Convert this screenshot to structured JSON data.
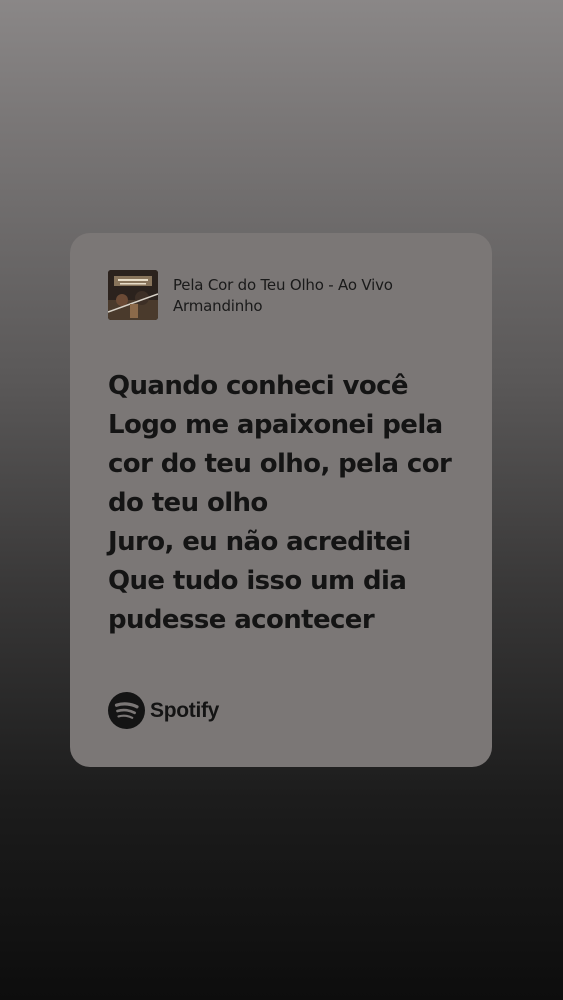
{
  "track": {
    "title": "Pela Cor do Teu Olho - Ao Vivo",
    "artist": "Armandinho",
    "cover_icon": "album-cover-image"
  },
  "lyrics": [
    "Quando conheci você",
    "Logo me apaixonei pela",
    "cor do teu olho, pela cor",
    "do teu olho",
    "Juro, eu não acreditei",
    "Que tudo isso um dia",
    "pudesse acontecer"
  ],
  "brand": {
    "name": "Spotify",
    "icon": "spotify-logo-icon"
  },
  "colors": {
    "card": "#7b7776",
    "text": "#141414"
  }
}
